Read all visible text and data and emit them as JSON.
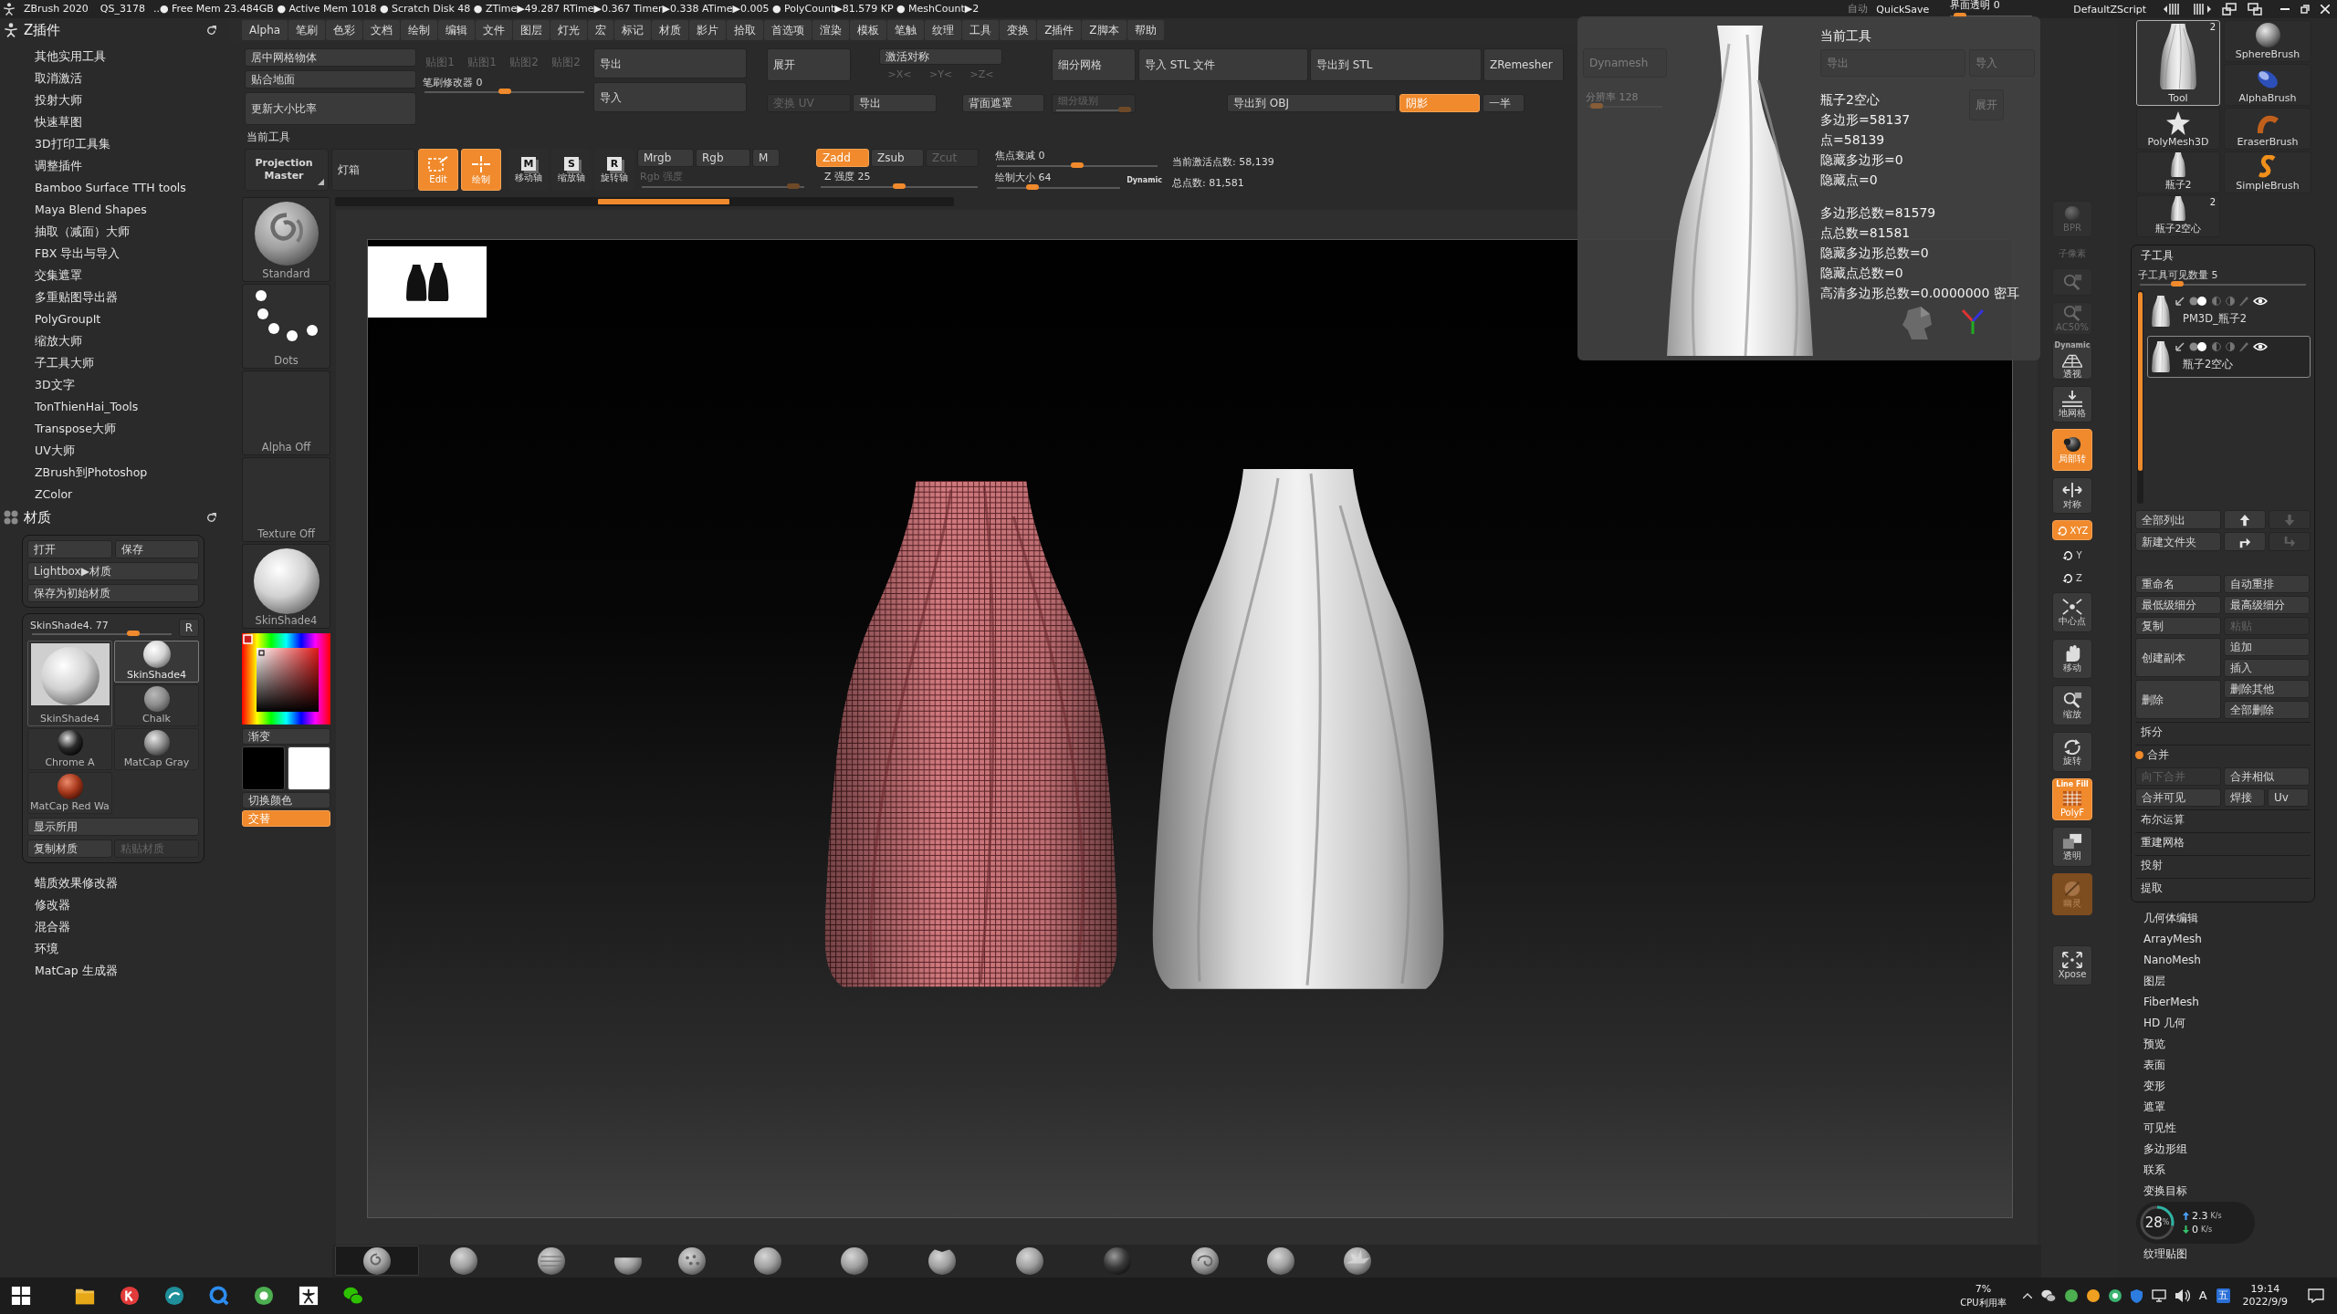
{
  "title_bar": {
    "app": "ZBrush 2020",
    "file": "QS_3178",
    "stats": "..● Free Mem 23.484GB ● Active Mem 1018 ● Scratch Disk 48 ● ZTime▶49.287 RTime▶0.367 Timer▶0.338 ATime▶0.005 ● PolyCount▶81.579 KP ● MeshCount▶2",
    "auto": "自动",
    "quicksave": "QuickSave",
    "transparency": {
      "label": "界面透明 0",
      "level": 0.05
    },
    "script": "DefaultZScript"
  },
  "menu": [
    "Alpha",
    "笔刷",
    "色彩",
    "文档",
    "绘制",
    "编辑",
    "文件",
    "图层",
    "灯光",
    "宏",
    "标记",
    "材质",
    "影片",
    "拾取",
    "首选项",
    "渲染",
    "模板",
    "笔触",
    "纹理",
    "工具",
    "变换",
    "Z插件",
    "Z脚本",
    "帮助"
  ],
  "plugins": {
    "title": "Z插件",
    "items": [
      "其他实用工具",
      "取消激活",
      "投射大师",
      "快速草图",
      "3D打印工具集",
      "调整插件",
      "Bamboo Surface TTH tools",
      "Maya Blend Shapes",
      "抽取（减面）大师",
      "FBX 导出与导入",
      "交集遮罩",
      "多重贴图导出器",
      "PolyGroupIt",
      "缩放大师",
      "子工具大师",
      "3D文字",
      "TonThienHai_Tools",
      "Transpose大师",
      "UV大师",
      "ZBrush到Photoshop",
      "ZColor"
    ]
  },
  "material": {
    "title": "材质",
    "file_buttons": [
      "打开",
      "保存"
    ],
    "lightbox": "Lightbox▶材质",
    "save_startup": "保存为初始材质",
    "current": {
      "label": "SkinShade4. 77",
      "level": 0.75
    },
    "reset": "R",
    "preview": "SkinShade4",
    "items": [
      {
        "label": "SkinShade4",
        "kind": "skin",
        "selected": true
      },
      {
        "label": "Chalk",
        "kind": "chalk",
        "selected": false
      },
      {
        "label": "Chrome A",
        "kind": "chrome",
        "selected": false
      },
      {
        "label": "MatCap Gray",
        "kind": "gray",
        "selected": false
      },
      {
        "label": "MatCap Red Wa",
        "kind": "red_wax",
        "selected": false
      }
    ],
    "show_used": "显示所用",
    "actions": [
      {
        "label": "复制材质",
        "disabled": false
      },
      {
        "label": "粘贴材质",
        "disabled": true
      }
    ],
    "more": [
      "蜡质效果修改器",
      "修改器",
      "混合器",
      "环境",
      "MatCap 生成器"
    ]
  },
  "shelf": {
    "items": [
      {
        "label": "Standard",
        "kind": "brush"
      },
      {
        "label": "Dots",
        "kind": "dots"
      },
      {
        "label": "Alpha Off",
        "kind": "empty"
      },
      {
        "label": "Texture Off",
        "kind": "empty"
      },
      {
        "label": "SkinShade4",
        "kind": "material"
      }
    ],
    "gradient": "渐变",
    "swatches": [
      {
        "color": "#000000"
      },
      {
        "color": "#ffffff"
      }
    ],
    "switch_color": "切换颜色",
    "alternate": {
      "label": "交替",
      "on": true
    }
  },
  "palette": {
    "tool_ops": [
      "居中网格物体",
      "贴合地面",
      "更新大小比率"
    ],
    "maps": [
      {
        "label": "贴图1",
        "disabled": true
      },
      {
        "label": "贴图1",
        "disabled": true
      },
      {
        "label": "贴图2",
        "disabled": true
      },
      {
        "label": "贴图2",
        "disabled": true
      }
    ],
    "brush_modifier": {
      "label": "笔刷修改器 0",
      "level": 0.5
    },
    "export": "导出",
    "import": "导入",
    "expand": "展开",
    "symmetry": "激活对称",
    "axes": [
      {
        "label": ">X<",
        "disabled": true
      },
      {
        "label": ">Y<",
        "disabled": true
      },
      {
        "label": ">Z<",
        "disabled": true
      }
    ],
    "row2": [
      {
        "label": "变换 UV",
        "disabled": true
      },
      {
        "label": "导出",
        "disabled": false
      },
      {
        "label": "背面遮罩",
        "disabled": false
      }
    ],
    "subdivide": "细分网格",
    "subdiv_level": {
      "label": "细分级别",
      "level": 1,
      "disabled": true
    },
    "stl_buttons": [
      "导入 STL 文件",
      "导出到 STL",
      "ZRemesher"
    ],
    "obj_row": [
      {
        "label": "导出到 OBJ",
        "on": false
      },
      {
        "label": "阴影",
        "on": true
      },
      {
        "label": "一半",
        "on": false
      }
    ]
  },
  "toolbar": {
    "title": "当前工具",
    "projection_master": "Projection Master",
    "lightbox": "灯箱",
    "modes": [
      {
        "label": "Edit",
        "kind": "edit",
        "on": true
      },
      {
        "label": "绘制",
        "kind": "draw",
        "on": true
      },
      {
        "label": "移动轴",
        "kind": "move",
        "badge": "M",
        "on": false
      },
      {
        "label": "缩放轴",
        "kind": "scale",
        "badge": "S",
        "on": false
      },
      {
        "label": "旋转轴",
        "kind": "rotate",
        "badge": "R",
        "on": false
      }
    ],
    "color_modes": [
      {
        "label": "Mrgb",
        "on": false
      },
      {
        "label": "Rgb",
        "on": false
      },
      {
        "label": "M",
        "on": false
      }
    ],
    "rgb_intensity": {
      "label": "Rgb 强度",
      "level": 0.97,
      "disabled": true
    },
    "z_modes": [
      {
        "label": "Zadd",
        "on": true,
        "disabled": false
      },
      {
        "label": "Zsub",
        "on": false,
        "disabled": false
      },
      {
        "label": "Zcut",
        "on": false,
        "disabled": true
      }
    ],
    "z_intensity": {
      "label": "Z 强度 25",
      "level": 0.5
    },
    "focal_shift": {
      "label": "焦点衰减 0",
      "level": 0.5
    },
    "draw_size": {
      "label": "绘制大小 64",
      "level": 0.26
    },
    "dynamic": "Dynamic",
    "active_points": "当前激活点数: 58,139",
    "total_points": "总点数: 81,581"
  },
  "tool_info": {
    "dynamesh": "Dynamesh",
    "resolution": {
      "label": "分辨率 128",
      "level": 0.05
    },
    "title": "当前工具",
    "export": "导出",
    "import": "导入",
    "expand": "展开",
    "tool_name": "瓶子2空心",
    "stats": [
      "多边形=58137",
      "点=58139",
      "隐藏多边形=0",
      "隐藏点=0"
    ],
    "totals": [
      "多边形总数=81579",
      "点总数=81581",
      "隐藏多边形总数=0",
      "隐藏点总数=0",
      "高清多边形总数=0.0000000 密耳"
    ]
  },
  "view_controls": [
    {
      "label": "BPR",
      "kind": "bpr",
      "on": false,
      "disabled": true
    },
    {
      "label": "子像素",
      "kind": "subpixel",
      "on": false,
      "disabled": true
    },
    {
      "kind": "zoom",
      "on": false,
      "disabled": true
    },
    {
      "label": "AC50%",
      "kind": "ac",
      "on": false,
      "disabled": true
    },
    {
      "caption": "Dynamic",
      "label": "透视",
      "kind": "perspective",
      "on": false,
      "disabled": false
    },
    {
      "label": "地网格",
      "kind": "floor",
      "on": false,
      "disabled": false
    },
    {
      "label": "局部转",
      "kind": "local",
      "on": true,
      "disabled": false
    },
    {
      "label": "对称",
      "kind": "symmetry",
      "on": false,
      "disabled": false
    },
    {
      "label": "XYZ",
      "kind": "rot_xyz",
      "on": true,
      "disabled": false
    },
    {
      "label": "Y",
      "kind": "rot_y",
      "on": false,
      "disabled": false
    },
    {
      "label": "Z",
      "kind": "rot_z",
      "on": false,
      "disabled": false
    },
    {
      "label": "中心点",
      "kind": "center",
      "on": false,
      "disabled": false
    },
    {
      "label": "移动",
      "kind": "move",
      "on": false,
      "disabled": false
    },
    {
      "label": "缩放",
      "kind": "scale",
      "on": false,
      "disabled": false
    },
    {
      "label": "旋转",
      "kind": "rotate",
      "on": false,
      "disabled": false
    },
    {
      "caption": "Line Fill",
      "label": "PolyF",
      "kind": "polyf",
      "on": true,
      "disabled": false
    },
    {
      "label": "透明",
      "kind": "transparent",
      "on": false,
      "disabled": false
    },
    {
      "label": "幽灵",
      "kind": "ghost",
      "on": true,
      "disabled": true
    },
    {
      "label": "Xpose",
      "kind": "xpose",
      "on": false,
      "disabled": false
    }
  ],
  "tools": [
    {
      "label": "Tool",
      "kind": "vase",
      "count": "2",
      "selected": true
    },
    {
      "label": "SphereBrush",
      "kind": "sphere",
      "selected": false
    },
    {
      "label": "AlphaBrush",
      "kind": "alpha",
      "selected": false
    },
    {
      "label": "PolyMesh3D",
      "kind": "star",
      "selected": false
    },
    {
      "label": "EraserBrush",
      "kind": "eraser",
      "selected": false
    },
    {
      "label": "瓶子2",
      "kind": "vase",
      "selected": false
    },
    {
      "label": "SimpleBrush",
      "kind": "simple",
      "selected": false
    },
    {
      "label": "瓶子2空心",
      "kind": "vase",
      "count": "2",
      "selected": false
    }
  ],
  "subtool": {
    "title": "子工具",
    "visible_count": {
      "label": "子工具可见数量 5",
      "level": 0.2
    },
    "items": [
      {
        "name": "PM3D_瓶子2",
        "selected": false,
        "visible": true
      },
      {
        "name": "瓶子2空心",
        "selected": true,
        "visible": true
      }
    ],
    "arrange": [
      {
        "label": "全部列出",
        "icons": [
          {
            "kind": "up",
            "disabled": false
          },
          {
            "kind": "down",
            "disabled": true
          }
        ]
      },
      {
        "label": "新建文件夹",
        "icons": [
          {
            "kind": "turn_right",
            "disabled": false
          },
          {
            "kind": "turn_down",
            "disabled": true
          }
        ]
      }
    ],
    "pairs": [
      [
        {
          "label": "重命名",
          "disabled": false
        },
        {
          "label": "自动重排",
          "disabled": false
        }
      ],
      [
        {
          "label": "最低级细分",
          "disabled": false
        },
        {
          "label": "最高级细分",
          "disabled": false
        }
      ],
      [
        {
          "label": "复制",
          "disabled": false
        },
        {
          "label": "粘贴",
          "disabled": true
        }
      ]
    ],
    "blocks": [
      {
        "label": "创建副本",
        "side": [
          {
            "label": "追加",
            "disabled": false
          },
          {
            "label": "插入",
            "disabled": false
          }
        ]
      },
      {
        "label": "删除",
        "side": [
          {
            "label": "删除其他",
            "disabled": false
          },
          {
            "label": "全部删除",
            "disabled": false
          }
        ]
      }
    ],
    "split": "拆分",
    "merge": {
      "label": "合并",
      "expanded": true,
      "rows": [
        [
          {
            "label": "向下合并",
            "disabled": true
          },
          {
            "label": "合并相似",
            "disabled": false
          }
        ],
        [
          {
            "label": "合并可见",
            "disabled": false
          },
          {
            "label": "焊接",
            "disabled": false
          },
          {
            "label": "Uv",
            "disabled": false
          }
        ]
      ]
    },
    "sections": [
      "布尔运算",
      "重建网格",
      "投射",
      "提取"
    ]
  },
  "tool_menu": [
    "几何体编辑",
    "ArrayMesh",
    "NanoMesh",
    "图层",
    "FiberMesh",
    "HD 几何",
    "预览",
    "表面",
    "变形",
    "遮罩",
    "可见性",
    "多边形组",
    "联系",
    "变换目标"
  ],
  "net_monitor": {
    "cpu": {
      "value": "28",
      "unit": "%"
    },
    "up": {
      "value": "2.3",
      "unit": "K/s"
    },
    "down": {
      "value": "0",
      "unit": "K/s"
    }
  },
  "tool_menu_end": "纹理贴图",
  "brush_shelf": [
    {
      "kind": "swirl",
      "selected": true
    },
    {
      "kind": "sphere",
      "selected": false
    },
    {
      "kind": "striped",
      "selected": false
    },
    {
      "kind": "flat",
      "selected": false
    },
    {
      "kind": "dotted",
      "selected": false
    },
    {
      "kind": "sphere",
      "selected": false
    },
    {
      "kind": "sphere",
      "selected": false
    },
    {
      "kind": "pinch",
      "selected": false
    },
    {
      "kind": "sphere",
      "selected": false
    },
    {
      "kind": "dark",
      "selected": false
    },
    {
      "kind": "curl",
      "selected": false
    },
    {
      "kind": "sphere",
      "selected": false
    },
    {
      "kind": "spiky",
      "selected": false
    }
  ],
  "taskbar": {
    "apps": [
      {
        "kind": "start"
      },
      {
        "kind": "explorer"
      },
      {
        "kind": "red_app"
      },
      {
        "kind": "teal_app"
      },
      {
        "kind": "browser"
      },
      {
        "kind": "green_app"
      },
      {
        "kind": "figure_app"
      },
      {
        "kind": "chat_app"
      }
    ],
    "cpu": {
      "value": "7%",
      "label": "CPU利用率"
    },
    "ime": "A",
    "ime_mode": "五",
    "time": "19:14",
    "date": "2022/9/9"
  }
}
